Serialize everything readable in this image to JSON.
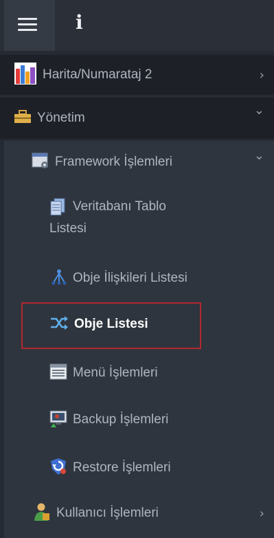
{
  "topbar": {
    "menu_icon": "hamburger-icon",
    "info_icon_glyph": "i"
  },
  "menu": {
    "harita": {
      "label": "Harita/Numarataj 2",
      "icon": "bar-chart-icon",
      "chevron": "›"
    },
    "yonetim": {
      "label": "Yönetim",
      "icon": "toolbox-icon",
      "chevron": "⌄"
    },
    "framework": {
      "label": "Framework İşlemleri",
      "icon": "window-gear-icon",
      "chevron": "⌄"
    },
    "veritabani": {
      "label_line1": "Veritabanı Tablo",
      "label_line2": "Listesi",
      "icon": "database-table-icon"
    },
    "iliskiler": {
      "label": "Obje İlişkileri Listesi",
      "icon": "hierarchy-icon"
    },
    "obje_listesi": {
      "label": "Obje Listesi",
      "icon": "shuffle-arrows-icon",
      "selected": true
    },
    "menu_islemleri": {
      "label": "Menü İşlemleri",
      "icon": "list-window-icon"
    },
    "backup": {
      "label": "Backup İşlemleri",
      "icon": "backup-monitor-icon"
    },
    "restore": {
      "label": "Restore İşlemleri",
      "icon": "restore-shield-icon"
    },
    "kullanici": {
      "label": "Kullanıcı İşlemleri",
      "icon": "user-icon",
      "chevron": "›"
    }
  },
  "colors": {
    "sidebar_bg": "#262b33",
    "submenu_bg": "#2f353e",
    "highlight_border": "#b3282f",
    "text": "#aeb6c1",
    "active_text": "#ffffff"
  }
}
